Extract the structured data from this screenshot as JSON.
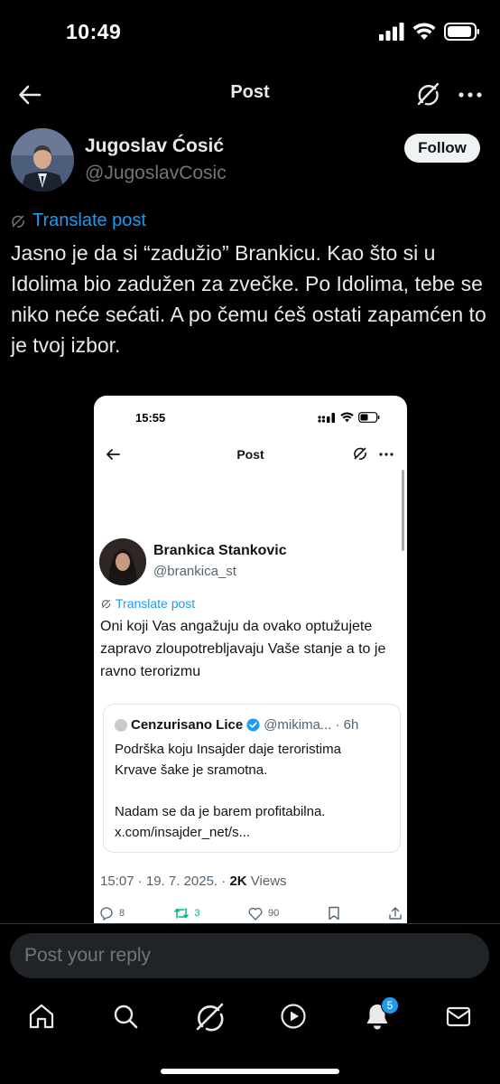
{
  "status_bar": {
    "time": "10:49"
  },
  "nav": {
    "title": "Post"
  },
  "post": {
    "author_name": "Jugoslav Ćosić",
    "author_handle": "@JugoslavCosic",
    "follow_label": "Follow",
    "translate_label": "Translate post",
    "text": "Jasno je da si “zadužio” Brankicu. Kao što si u Idolima bio zadužen za zvečke. Po Idolima, tebe se niko neće sećati. A po čemu ćeš ostati zapamćen to je tvoj izbor."
  },
  "embedded": {
    "time": "15:55",
    "title": "Post",
    "author_name": "Brankica Stankovic",
    "author_handle": "@brankica_st",
    "translate_label": "Translate post",
    "text": "Oni koji Vas angažuju da ovako optužujete zapravo zloupotrebljavaju Vaše stanje a to je ravno terorizmu",
    "quote": {
      "name": "Cenzurisano Lice",
      "handle": "@mikima...",
      "age": "· 6h",
      "text_line1": "Podrška koju Insajder daje teroristima Krvave šake je sramotna.",
      "text_line2": "Nadam se da je barem profitabilna. x.com/insajder_net/s..."
    },
    "meta_time": "15:07 · 19. 7. 2025. · ",
    "meta_views_count": "2K",
    "meta_views_label": " Views",
    "actions": {
      "replies": "8",
      "reposts": "3",
      "likes": "90"
    }
  },
  "reply": {
    "placeholder": "Post your reply"
  },
  "tabs": {
    "notifications_badge": "5"
  },
  "colors": {
    "accent": "#1d9bf0",
    "repost": "#00ba7c",
    "background": "#000000"
  }
}
